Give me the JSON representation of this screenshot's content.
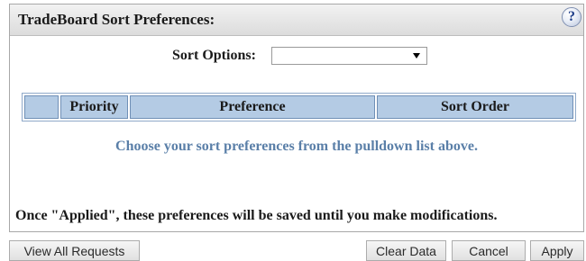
{
  "header": {
    "title": "TradeBoard Sort Preferences:",
    "help_icon_glyph": "?"
  },
  "sort_options": {
    "label": "Sort Options:",
    "selected_value": ""
  },
  "table": {
    "columns": [
      "",
      "Priority",
      "Preference",
      "Sort Order"
    ]
  },
  "empty_message": "Choose your sort preferences from the pulldown list above.",
  "footer_note": "Once \"Applied\", these preferences will be saved until you make modifications.",
  "buttons": {
    "view_all": "View All Requests",
    "clear_data": "Clear Data",
    "cancel": "Cancel",
    "apply": "Apply"
  },
  "colors": {
    "table_header_bg": "#b4cbe4",
    "message_text": "#5a7fa8"
  }
}
